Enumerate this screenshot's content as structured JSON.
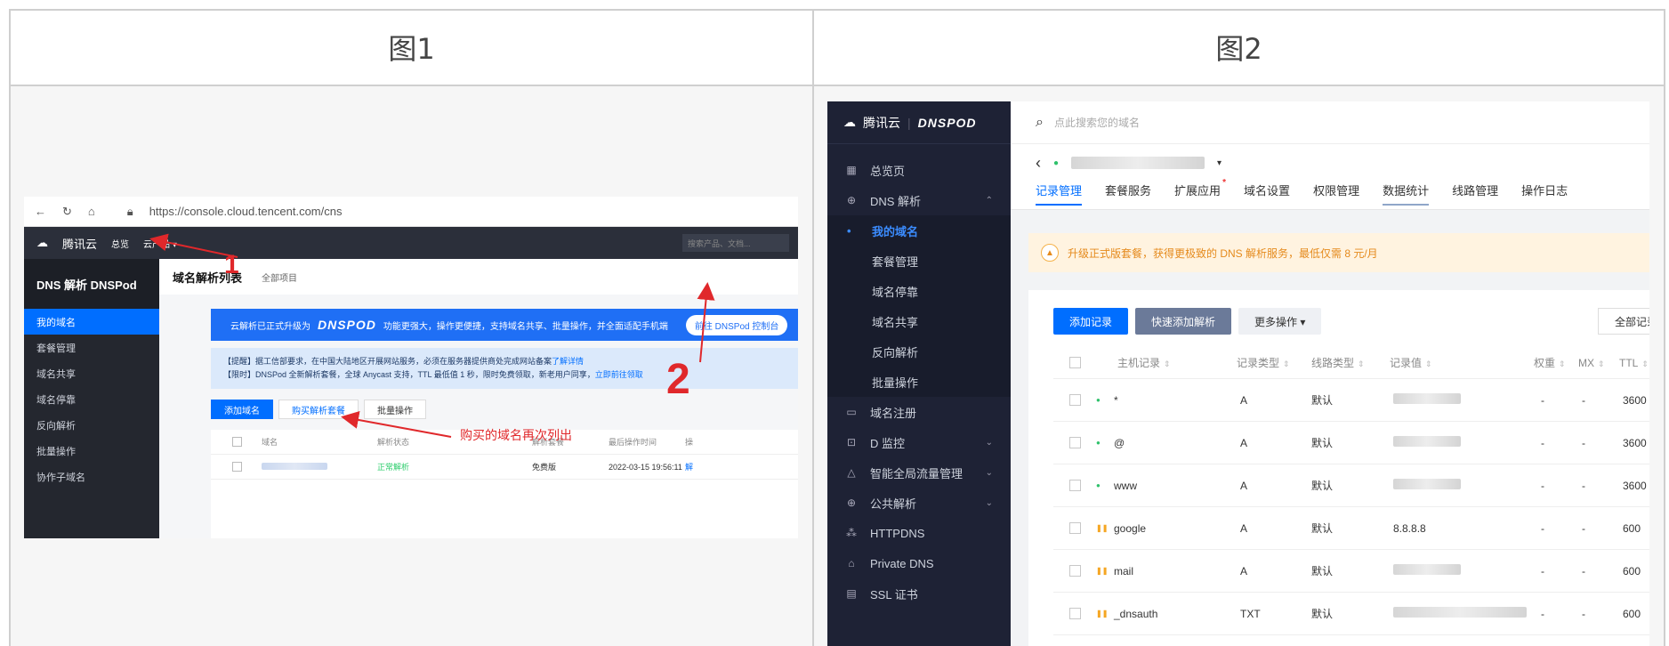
{
  "headers": {
    "fig1": "图1",
    "fig2": "图2"
  },
  "fig1": {
    "url": "https://console.cloud.tencent.com/cns",
    "brand": "腾讯云",
    "top_nav": [
      "总览",
      "云产品 ▾"
    ],
    "search_placeholder": "搜索产品、文档...",
    "sidebar_title": "DNS 解析 DNSPod",
    "sidebar_items": [
      "我的域名",
      "套餐管理",
      "域名共享",
      "域名停靠",
      "反向解析",
      "批量操作",
      "协作子域名"
    ],
    "page_title": "域名解析列表",
    "project_select": "全部项目",
    "banner_text1": "云解析已正式升级为",
    "banner_logo": "DNSPOD",
    "banner_text2": "功能更强大，操作更便捷，支持域名共享、批量操作，并全面适配手机端",
    "banner_button": "前往 DNSPod 控制台",
    "notice_line1": "【提醒】据工信部要求，在中国大陆地区开展网站服务，必须在服务器提供商处完成网站备案",
    "notice_link1": "了解详情",
    "notice_line2": "【限时】DNSPod 全新解析套餐，全球 Anycast 支持，TTL 最低值 1 秒，限时免费领取，新老用户同享，",
    "notice_link2": "立即前往领取",
    "actions": {
      "add": "添加域名",
      "buy": "购买解析套餐",
      "batch": "批量操作"
    },
    "table_headers": [
      "域名",
      "解析状态",
      "解析套餐",
      "最后操作时间",
      "操"
    ],
    "row": {
      "status": "正常解析",
      "plan": "免费版",
      "time": "2022-03-15 19:56:11",
      "op": "解"
    },
    "annotation_text": "购买的域名再次列出",
    "annotation_1": "1",
    "annotation_2": "2"
  },
  "fig2": {
    "brand": "腾讯云",
    "brand_logo": "DNSPOD",
    "search_placeholder": "点此搜索您的域名",
    "nav": [
      {
        "icon": "▦",
        "label": "总览页"
      },
      {
        "icon": "⊕",
        "label": "DNS 解析",
        "chev": "⌃"
      }
    ],
    "subnav": [
      "我的域名",
      "套餐管理",
      "域名停靠",
      "域名共享",
      "反向解析",
      "批量操作"
    ],
    "nav2": [
      {
        "icon": "▭",
        "label": "域名注册"
      },
      {
        "icon": "⊡",
        "label": "D 监控",
        "chev": "⌄"
      },
      {
        "icon": "△",
        "label": "智能全局流量管理",
        "chev": "⌄"
      },
      {
        "icon": "⊕",
        "label": "公共解析",
        "chev": "⌄"
      },
      {
        "icon": "⁂",
        "label": "HTTPDNS"
      },
      {
        "icon": "⌂",
        "label": "Private DNS"
      },
      {
        "icon": "▤",
        "label": "SSL 证书"
      }
    ],
    "tabs": [
      "记录管理",
      "套餐服务",
      "扩展应用",
      "域名设置",
      "权限管理",
      "数据统计",
      "线路管理",
      "操作日志"
    ],
    "warning": "升级正式版套餐，获得更极致的 DNS 解析服务，最低仅需 8 元/月",
    "buttons": {
      "add": "添加记录",
      "quick": "快速添加解析",
      "more": "更多操作 ▾",
      "all": "全部记录"
    },
    "columns": [
      "主机记录",
      "记录类型",
      "线路类型",
      "记录值",
      "权重",
      "MX",
      "TTL"
    ],
    "records": [
      {
        "host": "*",
        "type": "A",
        "line": "默认",
        "value": "",
        "weight": "-",
        "mx": "-",
        "ttl": "3600",
        "state": "on"
      },
      {
        "host": "@",
        "type": "A",
        "line": "默认",
        "value": "",
        "weight": "-",
        "mx": "-",
        "ttl": "3600",
        "state": "on"
      },
      {
        "host": "www",
        "type": "A",
        "line": "默认",
        "value": "",
        "weight": "-",
        "mx": "-",
        "ttl": "3600",
        "state": "on"
      },
      {
        "host": "google",
        "type": "A",
        "line": "默认",
        "value": "8.8.8.8",
        "weight": "-",
        "mx": "-",
        "ttl": "600",
        "state": "paused"
      },
      {
        "host": "mail",
        "type": "A",
        "line": "默认",
        "value": "",
        "weight": "-",
        "mx": "-",
        "ttl": "600",
        "state": "paused"
      },
      {
        "host": "_dnsauth",
        "type": "TXT",
        "line": "默认",
        "value": "",
        "weight": "-",
        "mx": "-",
        "ttl": "600",
        "state": "paused"
      }
    ]
  }
}
